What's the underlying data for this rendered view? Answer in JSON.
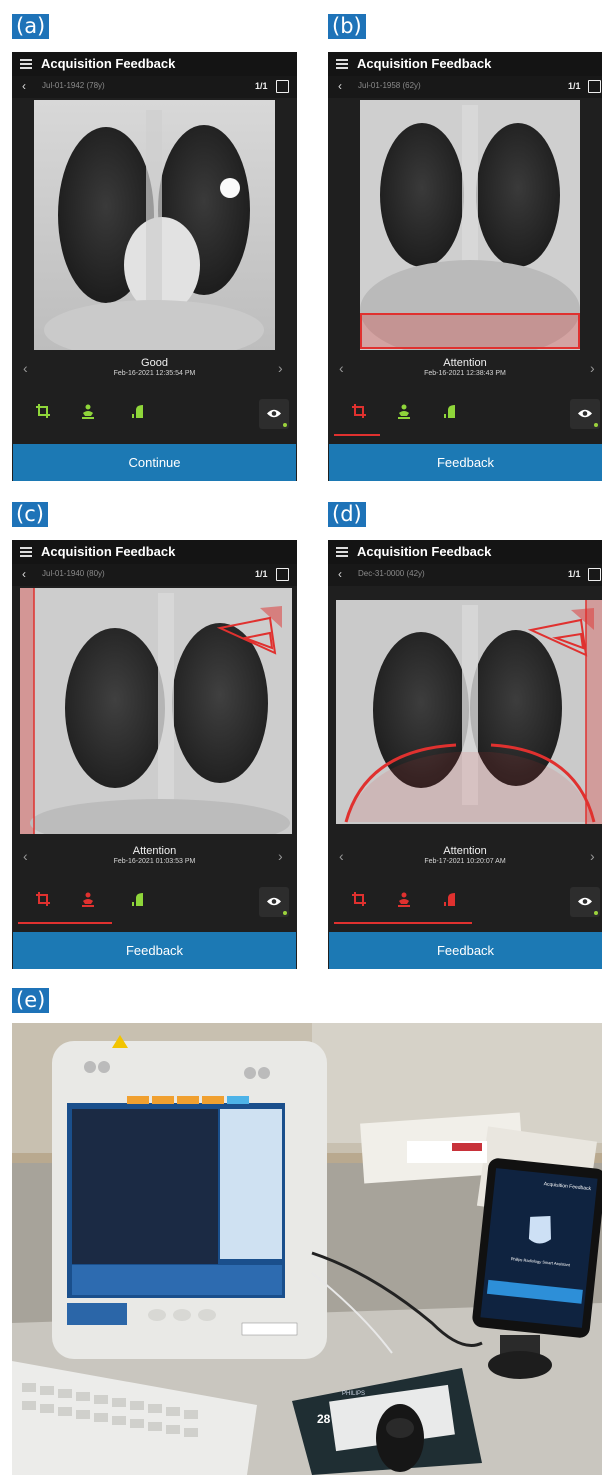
{
  "panels": [
    {
      "label": "(a)",
      "app_title": "Acquisition Feedback",
      "patient_id": "Jul-01-1942 (78y)",
      "image_count": "1/1",
      "status": "Good",
      "timestamp": "Feb-16-2021 12:35:54 PM",
      "action_button": "Continue",
      "icon_states": [
        "ok",
        "ok",
        "ok"
      ]
    },
    {
      "label": "(b)",
      "app_title": "Acquisition Feedback",
      "patient_id": "Jul-01-1958 (62y)",
      "image_count": "1/1",
      "status": "Attention",
      "timestamp": "Feb-16-2021 12:38:43 PM",
      "action_button": "Feedback",
      "icon_states": [
        "warn",
        "ok",
        "ok"
      ]
    },
    {
      "label": "(c)",
      "app_title": "Acquisition Feedback",
      "patient_id": "Jul-01-1940 (80y)",
      "image_count": "1/1",
      "status": "Attention",
      "timestamp": "Feb-16-2021 01:03:53 PM",
      "action_button": "Feedback",
      "icon_states": [
        "warn",
        "warn",
        "ok"
      ]
    },
    {
      "label": "(d)",
      "app_title": "Acquisition Feedback",
      "patient_id": "Dec-31-0000 (42y)",
      "image_count": "1/1",
      "status": "Attention",
      "timestamp": "Feb-17-2021 10:20:07 AM",
      "action_button": "Feedback",
      "icon_states": [
        "warn",
        "warn",
        "warn"
      ]
    }
  ],
  "photo_label": "(e)",
  "photo": {
    "console_brand": "PHILIPS",
    "tablet_title": "Acquisition Feedback",
    "tablet_caption": "Philips Radiology Smart Assistant",
    "mousepad_number": "28"
  },
  "colors": {
    "label_blue": "#1e73b8",
    "button_blue": "#1c79b4",
    "ok_green": "#8fd63a",
    "warn_red": "#e0312f"
  }
}
